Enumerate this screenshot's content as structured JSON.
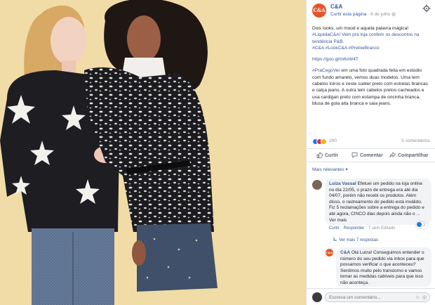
{
  "page": {
    "name": "C&A",
    "logo_text": "C&A",
    "follow_label": "Curtir esta página",
    "date": "8 de julho",
    "privacy_icon": "globe-icon"
  },
  "post": {
    "paragraph1": "Dois looks, um mood e aquela palavra mágica!",
    "hashtags1": "#LiquidaC&A! Vem pra loja conferir os descontos na tendência P&B.",
    "hashtags2": "#C&A #LookC&A #PretoeBranco",
    "link": "https://goo.gl/m6sW4T",
    "description_tag": "#PraCegoVer",
    "description": " em uma foto quadrada feita em estúdio com fundo amarelo, vemos duas modelos. Uma tem cabelos loiros e veste suéter preto com estrelas brancas e calça jeans. A outra tem cabelos pretos cacheados e usa cardigan preto com estampa de oncinha branca, blusa de gola alta branca e saia jeans."
  },
  "reactions": {
    "count": "290",
    "comments": "5 comentários",
    "icons": [
      "like-reaction",
      "love-reaction",
      "wow-reaction"
    ]
  },
  "actions": {
    "like": "Curtir",
    "comment": "Comentar",
    "share": "Compartilhar"
  },
  "comments_sort": "Mais relevantes ▾",
  "comment1": {
    "author": "Luiza Vassal",
    "text": " Efetuei um pedido na loja online no dia 22/05, o prazo de entrega era até dia 04/07, porém não recebi os produtos. Além disso, o rastreamento do pedido está inválido. Fiz 5 reclamações sobre a entrega do pedido e até agora, CINCO dias depois ainda não o ... Ver mais",
    "like_label": "Curtir",
    "reply_label": "Responder",
    "time": "7 sem",
    "edited": "Editado",
    "like_count": "2",
    "more_replies": "Ver mais 7 respostas"
  },
  "comment2": {
    "author": "C&A",
    "text": " Olá Luiza! Conseguimos entender o número do seu pedido via inbox para que possamos verificar o que aconteceu? Sentimos muito pelo transtorno e vamos tomar as medidas cabíveis para que isso não aconteça."
  },
  "composer": {
    "placeholder": "Escreva um comentário..."
  }
}
